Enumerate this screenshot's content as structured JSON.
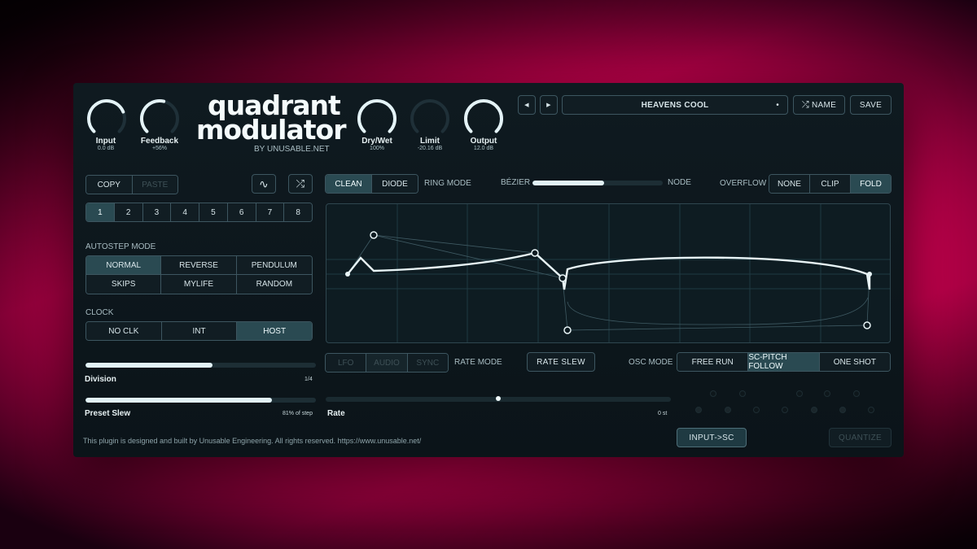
{
  "knobs": {
    "input": {
      "label": "Input",
      "value": "0.0 dB",
      "level": 0.75
    },
    "feedback": {
      "label": "Feedback",
      "value": "+56%",
      "level": 0.55
    },
    "drywet": {
      "label": "Dry/Wet",
      "value": "100%",
      "level": 1.0
    },
    "limit": {
      "label": "Limit",
      "value": "-20.16 dB",
      "level": 0.0
    },
    "output": {
      "label": "Output",
      "value": "12.0 dB",
      "level": 1.0
    }
  },
  "brand": {
    "line1": "quadrant",
    "line2": "modulator",
    "byline": "BY UNUSABLE.NET"
  },
  "preset": {
    "prev": "◀",
    "next": "▶",
    "name": "HEAVENS COOL",
    "dot": "•",
    "random_name": "NAME",
    "save": "SAVE"
  },
  "copy_paste": {
    "copy": "COPY",
    "paste": "PASTE"
  },
  "icons": {
    "wave": "sine-wave-icon",
    "shuffle": "shuffle-icon"
  },
  "steps": [
    "1",
    "2",
    "3",
    "4",
    "5",
    "6",
    "7",
    "8"
  ],
  "steps_active": 0,
  "autostep": {
    "title": "AUTOSTEP MODE",
    "options": [
      "NORMAL",
      "REVERSE",
      "PENDULUM",
      "SKIPS",
      "MYLIFE",
      "RANDOM"
    ],
    "active": 0
  },
  "clock": {
    "title": "CLOCK",
    "options": [
      "NO CLK",
      "INT",
      "HOST"
    ],
    "active": 2
  },
  "division": {
    "label": "Division",
    "value": "1/4",
    "level": 0.55
  },
  "preset_slew": {
    "label": "Preset Slew",
    "value": "81% of step",
    "level": 0.81
  },
  "ring_mode": {
    "options": [
      "CLEAN",
      "DIODE"
    ],
    "active": 0,
    "label": "RING MODE"
  },
  "curve": {
    "left_label": "BÉZIER",
    "right_label": "NODE",
    "level": 0.55
  },
  "overflow": {
    "label": "OVERFLOW",
    "options": [
      "NONE",
      "CLIP",
      "FOLD"
    ],
    "active": 2
  },
  "rate_mode": {
    "options": [
      "LFO",
      "AUDIO",
      "SYNC"
    ],
    "label": "RATE MODE",
    "rate_slew": "RATE SLEW"
  },
  "osc_mode": {
    "label": "OSC MODE",
    "options": [
      "FREE RUN",
      "SC-PITCH FOLLOW",
      "ONE SHOT"
    ],
    "active": 1
  },
  "rate": {
    "label": "Rate",
    "value": "0 st",
    "level": 0.5
  },
  "input_sc": "INPUT->SC",
  "quantize": "QUANTIZE",
  "footer": "This plugin is designed and built by Unusable Engineering. All rights reserved. https://www.unusable.net/",
  "colors": {
    "accent": "#e2f2f6",
    "active_bg": "#2a4a52",
    "panel": "#0f1a20",
    "background": "#f0005c"
  }
}
